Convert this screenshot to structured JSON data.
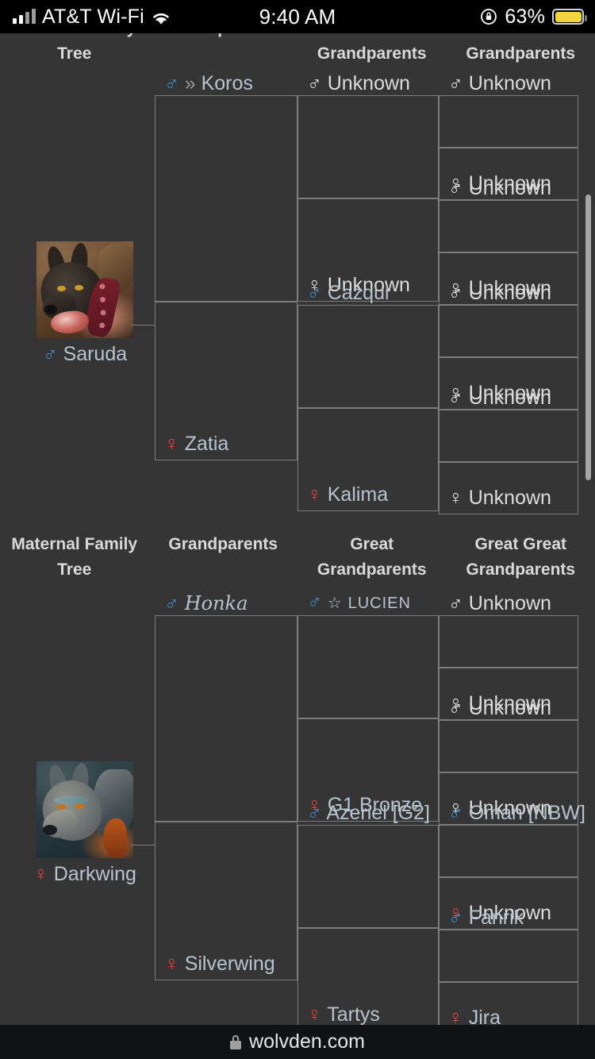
{
  "statusbar": {
    "carrier": "AT&T Wi-Fi",
    "time": "9:40 AM",
    "battery_pct": "63%",
    "battery_color": "#f2d43c",
    "signal_icon": "cellular-bars-icon",
    "wifi_icon": "wifi-icon",
    "rotation_lock_icon": "rotation-lock-icon",
    "battery_icon": "battery-icon"
  },
  "browser": {
    "url": "wolvden.com",
    "lock_icon": "lock-icon"
  },
  "theme": {
    "background": "#353535",
    "border": "#7c7c7c",
    "male": "#3e8ed0",
    "female": "#e0453a",
    "unknown": "#e3e3e3",
    "link": "#b7c4cd",
    "header_text": "#d9d9d9"
  },
  "paternal": {
    "headers": [
      "Paternal Family Tree",
      "Grandparents",
      "Great Grandparents",
      "Great Great Grandparents"
    ],
    "headers_visible": [
      "Tree",
      "Grandparents",
      "Grandparents"
    ],
    "subject": {
      "name": "Saruda",
      "sex": "male",
      "symbol": "♂",
      "portrait_alt": "dark wolf with spiked red collar eating meat"
    },
    "parents": [
      {
        "name": "Koros",
        "prefix": "»",
        "sex": "male",
        "symbol": "♂",
        "link": true
      },
      {
        "name": "Zatia",
        "sex": "female",
        "symbol": "♀",
        "link": true
      }
    ],
    "grandparents": [
      {
        "name": "Unknown",
        "sex": "unknown",
        "symbol": "♂",
        "link": false
      },
      {
        "name": "Unknown",
        "sex": "unknown",
        "symbol": "♀",
        "link": false
      },
      {
        "name": "Cazqui",
        "sex": "male",
        "symbol": "♂",
        "link": true
      },
      {
        "name": "Kalima",
        "sex": "female",
        "symbol": "♀",
        "link": true
      }
    ],
    "great_grandparents": [
      {
        "name": "Unknown",
        "sex": "unknown",
        "symbol": "♂",
        "link": false
      },
      {
        "name": "Unknown",
        "sex": "unknown",
        "symbol": "♀",
        "link": false
      },
      {
        "name": "Unknown",
        "sex": "unknown",
        "symbol": "♂",
        "link": false
      },
      {
        "name": "Unknown",
        "sex": "unknown",
        "symbol": "♀",
        "link": false
      },
      {
        "name": "Unknown",
        "sex": "unknown",
        "symbol": "♂",
        "link": false
      },
      {
        "name": "Unknown",
        "sex": "unknown",
        "symbol": "♀",
        "link": false
      },
      {
        "name": "Unknown",
        "sex": "unknown",
        "symbol": "♂",
        "link": false
      },
      {
        "name": "Unknown",
        "sex": "unknown",
        "symbol": "♀",
        "link": false
      }
    ]
  },
  "maternal": {
    "headers": [
      "Maternal Family Tree",
      "Grandparents",
      "Great Grandparents",
      "Great Great Grandparents"
    ],
    "subject": {
      "name": "Darkwing",
      "sex": "female",
      "symbol": "♀",
      "portrait_alt": "grey blue wolf on teal background"
    },
    "parents": [
      {
        "name": "Honka",
        "sex": "male",
        "symbol": "♂",
        "link": true,
        "style": "script"
      },
      {
        "name": "Silverwing",
        "sex": "female",
        "symbol": "♀",
        "link": true
      }
    ],
    "grandparents": [
      {
        "name": "LUCIEN",
        "prefix": "☆",
        "sex": "male",
        "symbol": "♂",
        "link": true,
        "style": "smallcaps"
      },
      {
        "name": "G1 Bronze",
        "sex": "female",
        "symbol": "♀",
        "link": true
      },
      {
        "name": "Azeriel [G2]",
        "sex": "male",
        "symbol": "♂",
        "link": true
      },
      {
        "name": "Tartys",
        "sex": "female",
        "symbol": "♀",
        "link": true
      }
    ],
    "great_grandparents": [
      {
        "name": "Unknown",
        "sex": "unknown",
        "symbol": "♂",
        "link": false
      },
      {
        "name": "Unknown",
        "sex": "unknown",
        "symbol": "♀",
        "link": false
      },
      {
        "name": "Unknown",
        "sex": "unknown",
        "symbol": "♂",
        "link": false
      },
      {
        "name": "Unknown",
        "sex": "unknown",
        "symbol": "♀",
        "link": false
      },
      {
        "name": "Oman [NBW]",
        "sex": "male",
        "symbol": "♂",
        "link": true
      },
      {
        "name": "Unknown",
        "sex": "female",
        "symbol": "♀",
        "link": false
      },
      {
        "name": "Fanrik",
        "sex": "male",
        "symbol": "♂",
        "link": true
      },
      {
        "name": "Jira",
        "sex": "female",
        "symbol": "♀",
        "link": true
      }
    ]
  },
  "scrollbar": {
    "visible": true
  }
}
